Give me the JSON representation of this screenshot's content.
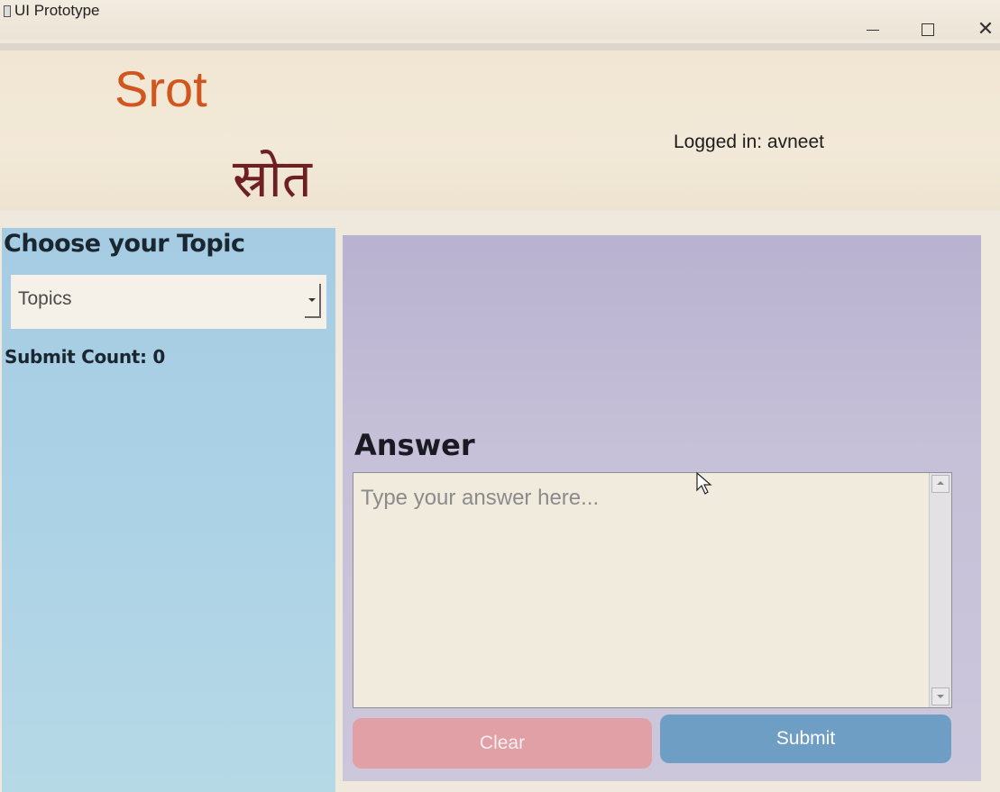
{
  "window": {
    "title": "UI Prototype",
    "minimize_icon": "minimize-icon",
    "maximize_icon": "maximize-icon",
    "close_icon": "close-icon",
    "close_glyph": "✕"
  },
  "header": {
    "brand_en": "Srot",
    "brand_hi": "स्रोत",
    "login_text": "Logged in: avneet",
    "colors": {
      "brand_en": "#d1551f",
      "brand_hi": "#6e1f22"
    }
  },
  "left_panel": {
    "heading": "Choose your Topic",
    "topic_select": {
      "selected": "Topics"
    },
    "submit_count": "Submit Count: 0"
  },
  "right_panel": {
    "answer_label": "Answer",
    "answer_input": {
      "value": "",
      "placeholder": "Type your answer here..."
    },
    "clear_button": "Clear",
    "submit_button": "Submit",
    "colors": {
      "clear": "#e0a0a6",
      "submit": "#6f9ec4"
    }
  }
}
